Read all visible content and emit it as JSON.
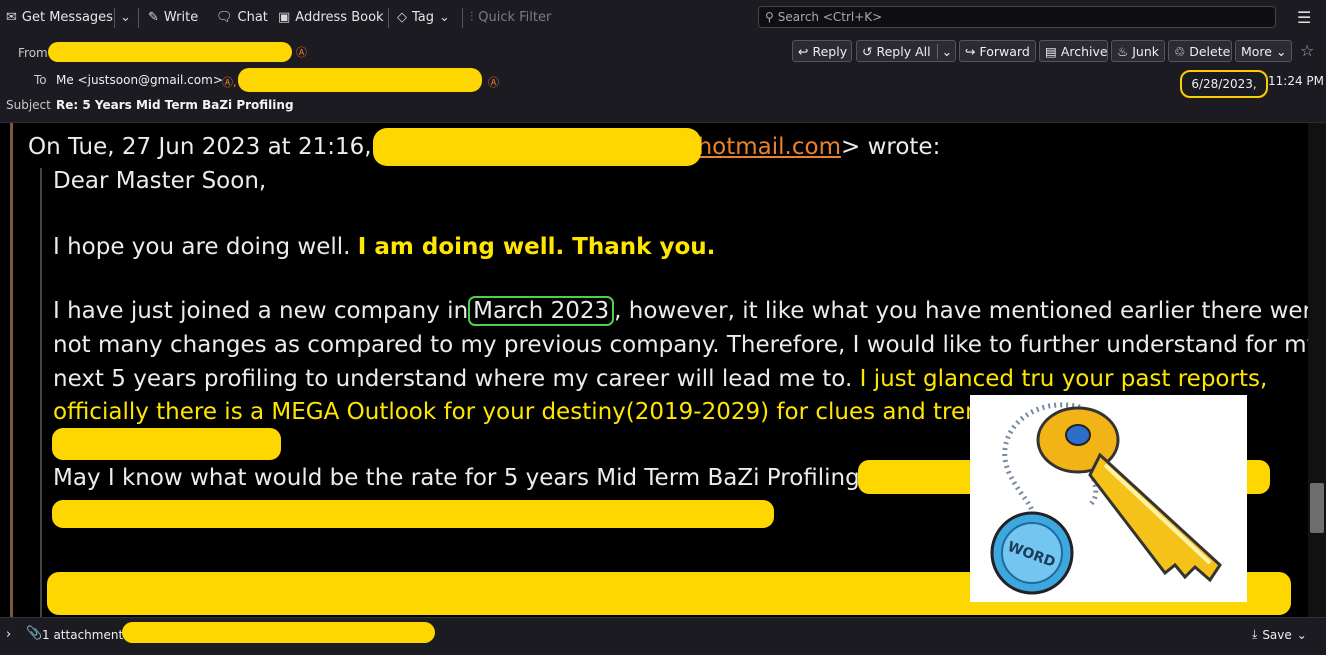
{
  "toolbar": {
    "get_messages": "Get Messages",
    "write": "Write",
    "chat": "Chat",
    "address_book": "Address Book",
    "tag": "Tag",
    "quick_filter": "Quick Filter",
    "search_placeholder": "Search <Ctrl+K>"
  },
  "header": {
    "from_label": "From",
    "to_label": "To",
    "to_value": "Me <justsoon@gmail.com>",
    "subject_label": "Subject",
    "subject": "Re: 5 Years Mid Term BaZi Profiling",
    "date": "6/28/2023,",
    "time": "11:24 PM",
    "actions": {
      "reply": "Reply",
      "reply_all": "Reply All",
      "forward": "Forward",
      "archive": "Archive",
      "junk": "Junk",
      "delete": "Delete",
      "more": "More"
    }
  },
  "message": {
    "quote_header_pre": "On Tue, 27 Jun 2023 at 21:16,",
    "quote_header_link": "hotmail.com",
    "quote_header_post": "> wrote:",
    "greeting": "Dear Master Soon,",
    "line1_normal": "I hope you are doing well.",
    "line1_reply": "I am doing well. Thank you.",
    "para2_a": "I have just joined a new company in",
    "para2_highlight": "March 2023",
    "para2_b": ", however, it like what you have mentioned earlier there were",
    "para2_line2": "not many changes as compared to my previous company. Therefore, I would like to further understand for my",
    "para2_line3": "next 5 years profiling to understand where my career will lead me to.",
    "reply2_a": "I just glanced tru your past reports,",
    "reply2_b": "officially there is a MEGA Outlook for your destiny(2019-2029) for clues and trend.",
    "question": "May I know what would be the rate for 5 years Mid Term BaZi Profiling?",
    "clipart_word": "WORD"
  },
  "attachment": {
    "label": "1 attachment:",
    "save": "Save"
  },
  "colors": {
    "redaction": "#ffd700",
    "reply_text": "#ffe600",
    "link": "#e8822c",
    "highlight_box": "#4fcf4f",
    "date_circle": "#ffcc00"
  }
}
